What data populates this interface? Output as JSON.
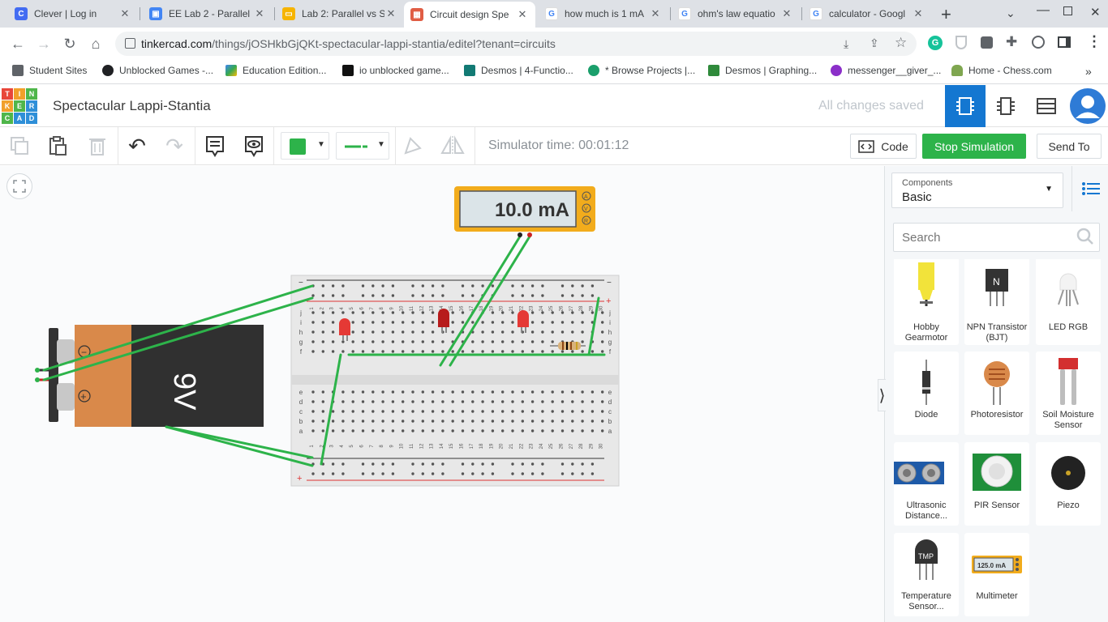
{
  "browser": {
    "tabs": [
      {
        "title": "Clever | Log in",
        "color": "#436cf2",
        "glyph": "C"
      },
      {
        "title": "EE Lab 2 - Parallel",
        "color": "#4285f4",
        "glyph": "▣"
      },
      {
        "title": "Lab 2: Parallel vs S",
        "color": "#f6b400",
        "glyph": "▭"
      },
      {
        "title": "Circuit design Spe",
        "color": "#e05d44",
        "glyph": "▦"
      },
      {
        "title": "how much is 1 mA",
        "color": "#4285f4",
        "glyph": "G"
      },
      {
        "title": "ohm's law equatio",
        "color": "#4285f4",
        "glyph": "G"
      },
      {
        "title": "calculator - Googl",
        "color": "#4285f4",
        "glyph": "G"
      }
    ],
    "active_tab_index": 3,
    "url_host": "tinkercad.com",
    "url_path": "/things/jOSHkbGjQKt-spectacular-lappi-stantia/editel?tenant=circuits",
    "bookmarks": [
      {
        "label": "Student Sites",
        "color": "#5f6368"
      },
      {
        "label": "Unblocked Games -...",
        "color": "#202124"
      },
      {
        "label": "Education Edition...",
        "color": "#34a853"
      },
      {
        "label": "io unblocked game...",
        "color": "#111111"
      },
      {
        "label": "Desmos | 4-Functio...",
        "color": "#127a74"
      },
      {
        "label": "* Browse Projects |...",
        "color": "#1a9f6b"
      },
      {
        "label": "Desmos | Graphing...",
        "color": "#2f8a3b"
      },
      {
        "label": "messenger__giver_...",
        "color": "#8b2fc9"
      },
      {
        "label": "Home - Chess.com",
        "color": "#7fa650"
      }
    ]
  },
  "app": {
    "logo_letters": [
      "T",
      "I",
      "N",
      "K",
      "E",
      "R",
      "C",
      "A",
      "D"
    ],
    "project_title": "Spectacular Lappi-Stantia",
    "save_status": "All changes saved"
  },
  "toolbar": {
    "simulator_time": "Simulator time: 00:01:12",
    "code_label": "Code",
    "stop_label": "Stop Simulation",
    "send_label": "Send To",
    "accent_green": "#2db34a"
  },
  "canvas": {
    "multimeter_reading": "10.0 mA",
    "multimeter_modes": [
      "A",
      "V",
      "R"
    ],
    "battery_label": "9V",
    "battery_terminals": [
      "−",
      "+"
    ],
    "breadboard_rows": [
      "a",
      "b",
      "c",
      "d",
      "e",
      "f",
      "g",
      "h",
      "i",
      "j"
    ],
    "breadboard_cols": [
      "1",
      "2",
      "3",
      "4",
      "5",
      "6",
      "7",
      "8",
      "9",
      "10",
      "11",
      "12",
      "13",
      "14",
      "15",
      "16",
      "17",
      "18",
      "19",
      "20",
      "21",
      "22",
      "23",
      "24",
      "25",
      "26",
      "27",
      "28",
      "29",
      "30"
    ]
  },
  "panel": {
    "components_caption": "Components",
    "components_value": "Basic",
    "search_placeholder": "Search",
    "items": [
      {
        "label": "Hobby Gearmotor",
        "icon": "gearmotor-icon"
      },
      {
        "label": "NPN Transistor (BJT)",
        "icon": "npn-transistor-icon"
      },
      {
        "label": "LED RGB",
        "icon": "led-rgb-icon"
      },
      {
        "label": "Diode",
        "icon": "diode-icon"
      },
      {
        "label": "Photoresistor",
        "icon": "photoresistor-icon"
      },
      {
        "label": "Soil Moisture Sensor",
        "icon": "soil-moisture-icon"
      },
      {
        "label": "Ultrasonic Distance...",
        "icon": "ultrasonic-icon"
      },
      {
        "label": "PIR Sensor",
        "icon": "pir-sensor-icon"
      },
      {
        "label": "Piezo",
        "icon": "piezo-icon"
      },
      {
        "label": "Temperature Sensor...",
        "icon": "temperature-sensor-icon"
      },
      {
        "label": "Multimeter",
        "icon": "multimeter-icon"
      }
    ],
    "npn_letter": "N",
    "tmp_text": "TMP",
    "multimeter_thumb_text": "125.0 mA"
  }
}
